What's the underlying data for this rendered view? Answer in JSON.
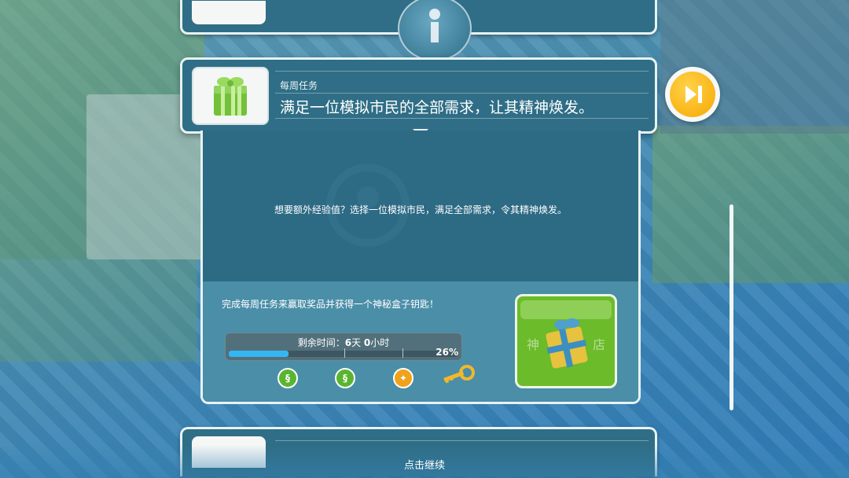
{
  "quest": {
    "subtitle": "每周任务",
    "title": "满足一位模拟市民的全部需求，让其精神焕发。",
    "icon": "gift-icon"
  },
  "detail": {
    "description": "想要额外经验值？选择一位模拟市民，满足全部需求，令其精神焕发。"
  },
  "reward": {
    "text": "完成每周任务来赢取奖品并获得一个神秘盒子钥匙！",
    "time_prefix": "剩余时间：",
    "days": "6",
    "days_unit": "天",
    "hours": "0",
    "hours_unit": "小时",
    "progress": 0.26,
    "progress_label": "26%",
    "milestones": [
      {
        "icon": "simoleon-icon",
        "glyph": "§"
      },
      {
        "icon": "simoleon-icon",
        "glyph": "§"
      },
      {
        "icon": "lifestyle-points-icon",
        "glyph": "✦"
      },
      {
        "icon": "key-icon",
        "glyph": ""
      }
    ],
    "mystery_box_left": "神",
    "mystery_box_right": "店"
  },
  "footer": {
    "tap_to_continue": "点击继续"
  },
  "colors": {
    "panel": "#2f6e86",
    "accent_yellow": "#f6a800",
    "progress_fill": "#34b6f3",
    "mystery_box": "#6cbb2a"
  }
}
